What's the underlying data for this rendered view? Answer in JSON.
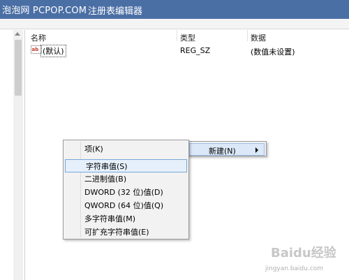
{
  "titlebar": {
    "watermark": "泡泡网  PCPOP.COM",
    "title": "注册表编辑器"
  },
  "list": {
    "headers": {
      "name": "名称",
      "type": "类型",
      "data": "数据"
    },
    "rows": [
      {
        "name": "(默认)",
        "type": "REG_SZ",
        "data": "(数值未设置)"
      }
    ]
  },
  "main_menu": {
    "new_label": "新建(N)"
  },
  "sub_menu": {
    "items": [
      {
        "label": "项(K)"
      },
      {
        "label": "字符串值(S)",
        "highlighted": true
      },
      {
        "label": "二进制值(B)"
      },
      {
        "label": "DWORD (32 位)值(D)"
      },
      {
        "label": "QWORD (64 位)值(Q)"
      },
      {
        "label": "多字符串值(M)"
      },
      {
        "label": "可扩充字符串值(E)"
      }
    ]
  },
  "corner_logo": {
    "text": "Baidu经验",
    "url": "jingyan.baidu.com"
  },
  "colors": {
    "titlebar": "#4a6fa5",
    "menu_highlight": "#e5f0fb",
    "menu_border": "#9a9a9a"
  }
}
